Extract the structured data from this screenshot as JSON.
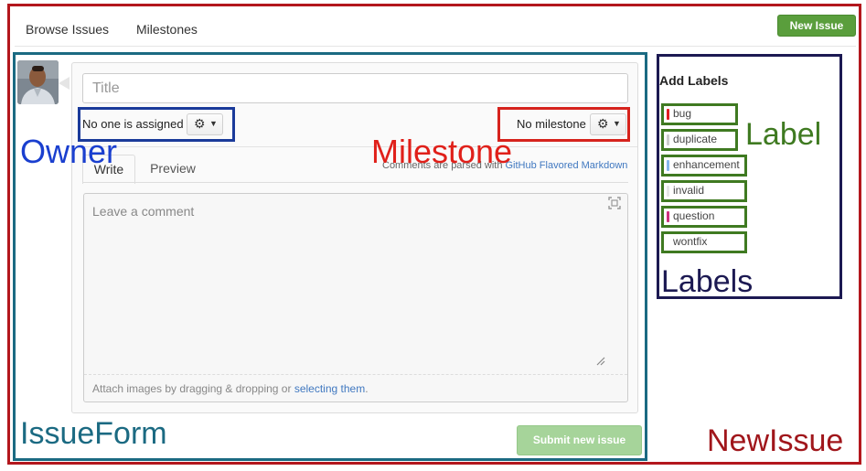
{
  "nav": {
    "browse_issues": "Browse Issues",
    "milestones": "Milestones",
    "new_issue_button": "New Issue"
  },
  "form": {
    "title_placeholder": "Title",
    "assignee_text": "No one is assigned",
    "milestone_text": "No milestone",
    "tabs": [
      "Write",
      "Preview"
    ],
    "markdown_note_prefix": "Comments are parsed with ",
    "markdown_link": "GitHub Flavored Markdown",
    "comment_placeholder": "Leave a comment",
    "attach_prefix": "Attach images by dragging & dropping or ",
    "attach_link": "selecting them",
    "attach_suffix": ".",
    "submit_button": "Submit new issue"
  },
  "labels": {
    "heading": "Add Labels",
    "items": [
      {
        "name": "bug",
        "color": "#e11d21"
      },
      {
        "name": "duplicate",
        "color": "#cccccc"
      },
      {
        "name": "enhancement",
        "color": "#84b6eb"
      },
      {
        "name": "invalid",
        "color": "#e6e6e6"
      },
      {
        "name": "question",
        "color": "#cc317c"
      },
      {
        "name": "wontfix",
        "color": "#ffffff"
      }
    ]
  },
  "annotations": {
    "owner": "Owner",
    "milestone": "Milestone",
    "label": "Label",
    "labels": "Labels",
    "issue_form": "IssueForm",
    "new_issue": "NewIssue"
  },
  "colors": {
    "new_issue_frame": "#b3171d",
    "issue_form_frame": "#1b6a82",
    "owner_frame": "#1a3a9a",
    "milestone_frame": "#d6231d",
    "labels_frame": "#1c1952",
    "label_frame": "#3f7a21",
    "primary_button": "#5a9e3c"
  },
  "icons": {
    "settings": "gear-icon",
    "dropdown": "caret-down-icon",
    "fullscreen": "fullscreen-icon",
    "resize": "resize-grip-icon"
  }
}
